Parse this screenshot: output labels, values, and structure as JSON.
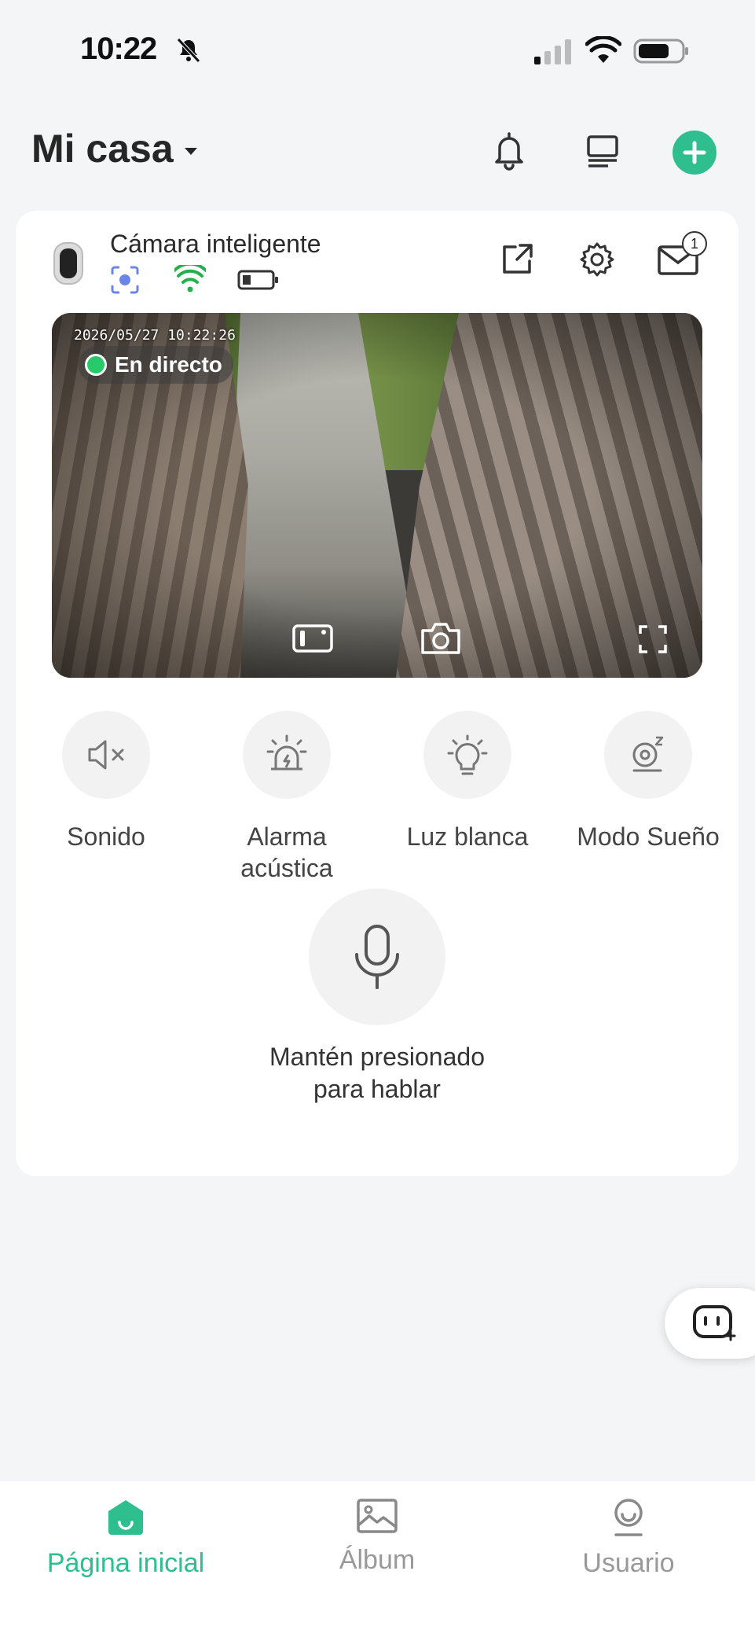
{
  "status_bar": {
    "time": "10:22"
  },
  "header": {
    "home_name": "Mi casa"
  },
  "device": {
    "name": "Cámara inteligente",
    "notification_count": "1"
  },
  "video": {
    "timestamp": "2026/05/27  10:22:26",
    "live_label": "En directo"
  },
  "controls": [
    {
      "label": "Sonido",
      "icon": "speaker-muted-icon"
    },
    {
      "label": "Alarma acústica",
      "icon": "siren-icon"
    },
    {
      "label": "Luz blanca",
      "icon": "light-bulb-icon"
    },
    {
      "label": "Modo Sueño",
      "icon": "sleep-mode-icon"
    }
  ],
  "talk": {
    "label": "Mantén presionado para hablar"
  },
  "nav": {
    "items": [
      {
        "label": "Página inicial",
        "icon": "home-icon",
        "active": true
      },
      {
        "label": "Álbum",
        "icon": "album-icon",
        "active": false
      },
      {
        "label": "Usuario",
        "icon": "user-icon",
        "active": false
      }
    ]
  },
  "colors": {
    "accent": "#2fbf8f",
    "live": "#27c96a",
    "background": "#f4f5f7"
  }
}
